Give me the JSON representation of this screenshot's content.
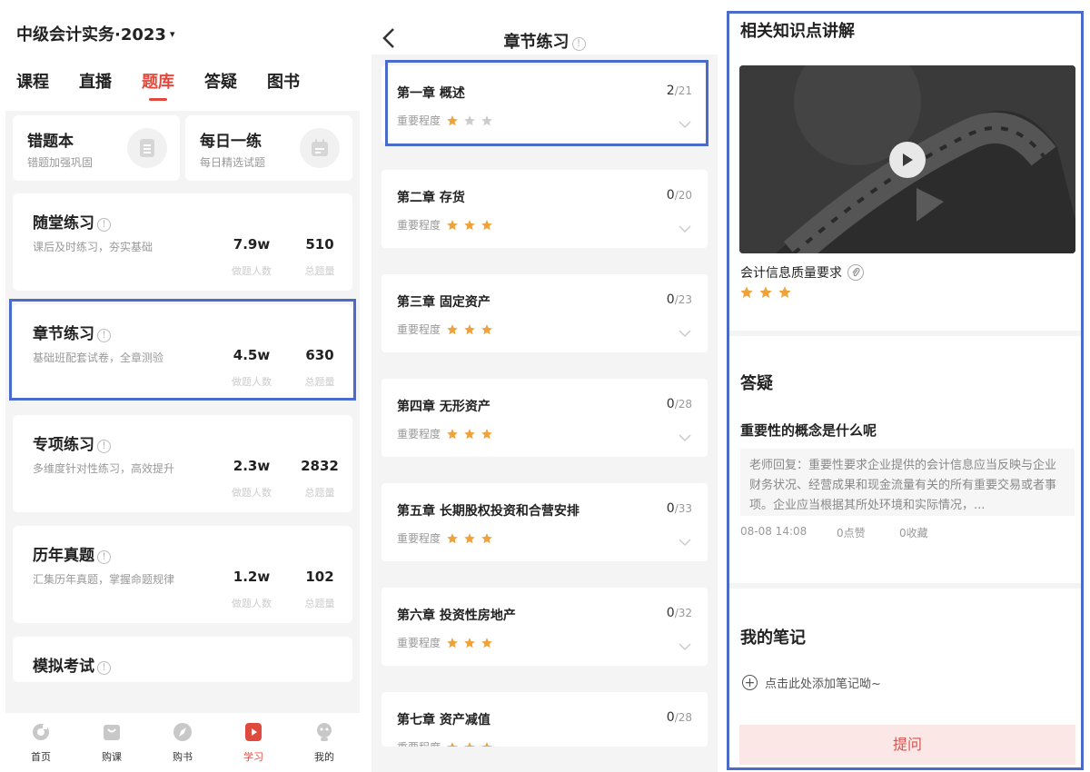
{
  "colors": {
    "accent": "#e04a3e",
    "star_on": "#f0a23a",
    "star_off": "#cccccc",
    "highlight": "#4a6bc9"
  },
  "course": {
    "title": "中级会计实务·2023",
    "caret": "▾"
  },
  "tabs": [
    {
      "label": "课程"
    },
    {
      "label": "直播"
    },
    {
      "label": "题库",
      "active": true
    },
    {
      "label": "答疑"
    },
    {
      "label": "图书"
    }
  ],
  "quick_cards": [
    {
      "title": "错题本",
      "subtitle": "错题加强巩固",
      "icon": "notebook-icon"
    },
    {
      "title": "每日一练",
      "subtitle": "每日精选试题",
      "icon": "calendar-icon"
    }
  ],
  "practice": [
    {
      "title": "随堂练习",
      "desc": "课后及时练习，夯实基础",
      "people": "7.9w",
      "people_label": "做题人数",
      "total": "510",
      "total_label": "总题量"
    },
    {
      "title": "章节练习",
      "desc": "基础班配套试卷，全章测验",
      "people": "4.5w",
      "people_label": "做题人数",
      "total": "630",
      "total_label": "总题量"
    },
    {
      "title": "专项练习",
      "desc": "多维度针对性练习，高效提升",
      "people": "2.3w",
      "people_label": "做题人数",
      "total": "2832",
      "total_label": "总题量"
    },
    {
      "title": "历年真题",
      "desc": "汇集历年真题，掌握命题规律",
      "people": "1.2w",
      "people_label": "做题人数",
      "total": "102",
      "total_label": "总题量"
    },
    {
      "title": "模拟考试"
    }
  ],
  "tabbar": [
    {
      "label": "首页",
      "icon": "home-icon"
    },
    {
      "label": "购课",
      "icon": "bag-icon"
    },
    {
      "label": "购书",
      "icon": "compass-icon"
    },
    {
      "label": "学习",
      "icon": "play-icon",
      "active": true
    },
    {
      "label": "我的",
      "icon": "profile-icon"
    }
  ],
  "chapter_page": {
    "title": "章节练习",
    "importance_label": "重要程度",
    "chapters": [
      {
        "name": "第一章 概述",
        "done": "2",
        "total": "/21",
        "stars": 1
      },
      {
        "name": "第二章 存货",
        "done": "0",
        "total": "/20",
        "stars": 3
      },
      {
        "name": "第三章 固定资产",
        "done": "0",
        "total": "/23",
        "stars": 3
      },
      {
        "name": "第四章 无形资产",
        "done": "0",
        "total": "/28",
        "stars": 3
      },
      {
        "name": "第五章 长期股权投资和合营安排",
        "done": "0",
        "total": "/33",
        "stars": 3
      },
      {
        "name": "第六章 投资性房地产",
        "done": "0",
        "total": "/32",
        "stars": 3
      },
      {
        "name": "第七章 资产减值",
        "done": "0",
        "total": "/28",
        "stars": 3
      }
    ]
  },
  "detail": {
    "knowledge_title": "相关知识点讲解",
    "video_title": "会计信息质量要求",
    "video_stars": 3,
    "qa_title": "答疑",
    "question": "重要性的概念是什么呢",
    "reply": "老师回复：重要性要求企业提供的会计信息应当反映与企业财务状况、经营成果和现金流量有关的所有重要交易或者事项。企业应当根据其所处环境和实际情况，...",
    "date": "08-08 14:08",
    "likes": "0点赞",
    "favorites": "0收藏",
    "notes_title": "我的笔记",
    "add_note": "点击此处添加笔记呦~",
    "ask_button": "提问"
  }
}
